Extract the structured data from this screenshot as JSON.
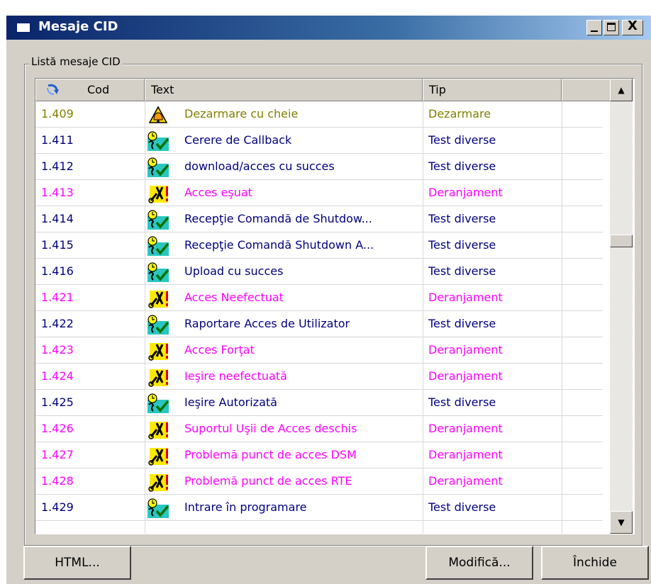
{
  "window": {
    "title": "Mesaje CID",
    "minimize_glyph": "_",
    "close_glyph": "X"
  },
  "group_label": "Listă mesaje CID",
  "columns": {
    "code": "Cod",
    "text": "Text",
    "type": "Tip"
  },
  "scrollbar": {
    "up": "▲",
    "down": "▼"
  },
  "rows": [
    {
      "code": "1.409",
      "icon": "bell-alarm-icon",
      "text": "Dezarmare cu cheie",
      "type": "Dezarmare",
      "color": "#808000"
    },
    {
      "code": "1.411",
      "icon": "test-check-icon",
      "text": "Cerere de Callback",
      "type": "Test diverse",
      "color": "#000080"
    },
    {
      "code": "1.412",
      "icon": "test-check-icon",
      "text": "download/acces cu succes",
      "type": "Test diverse",
      "color": "#000080"
    },
    {
      "code": "1.413",
      "icon": "tools-fault-icon",
      "text": "Acces eşuat",
      "type": "Deranjament",
      "color": "#ff00ff"
    },
    {
      "code": "1.414",
      "icon": "test-check-icon",
      "text": "Recepţie Comandă de Shutdow...",
      "type": "Test diverse",
      "color": "#000080"
    },
    {
      "code": "1.415",
      "icon": "test-check-icon",
      "text": "Recepţie Comandă Shutdown A...",
      "type": "Test diverse",
      "color": "#000080"
    },
    {
      "code": "1.416",
      "icon": "test-check-icon",
      "text": "Upload cu succes",
      "type": "Test diverse",
      "color": "#000080"
    },
    {
      "code": "1.421",
      "icon": "tools-fault-icon",
      "text": "Acces Neefectuat",
      "type": "Deranjament",
      "color": "#ff00ff"
    },
    {
      "code": "1.422",
      "icon": "test-check-icon",
      "text": "Raportare Acces de Utilizator",
      "type": "Test diverse",
      "color": "#000080"
    },
    {
      "code": "1.423",
      "icon": "tools-fault-icon",
      "text": "Acces Forţat",
      "type": "Deranjament",
      "color": "#ff00ff"
    },
    {
      "code": "1.424",
      "icon": "tools-fault-icon",
      "text": "Ieşire neefectuată",
      "type": "Deranjament",
      "color": "#ff00ff"
    },
    {
      "code": "1.425",
      "icon": "test-check-icon",
      "text": "Ieşire Autorizată",
      "type": "Test diverse",
      "color": "#000080"
    },
    {
      "code": "1.426",
      "icon": "tools-fault-icon",
      "text": "Suportul Uşii de Acces deschis",
      "type": "Deranjament",
      "color": "#ff00ff"
    },
    {
      "code": "1.427",
      "icon": "tools-fault-icon",
      "text": "Problemă punct de acces DSM",
      "type": "Deranjament",
      "color": "#ff00ff"
    },
    {
      "code": "1.428",
      "icon": "tools-fault-icon",
      "text": "Problemă punct de acces RTE",
      "type": "Deranjament",
      "color": "#ff00ff"
    },
    {
      "code": "1.429",
      "icon": "test-check-icon",
      "text": "Intrare în programare",
      "type": "Test diverse",
      "color": "#000080"
    }
  ],
  "buttons": {
    "html": "HTML...",
    "modify": "Modifică...",
    "close": "Închide"
  }
}
